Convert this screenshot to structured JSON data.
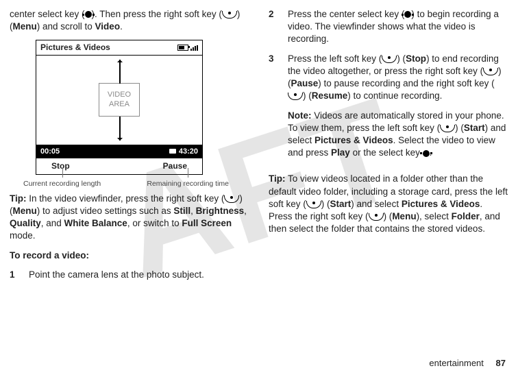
{
  "watermark": "AFT",
  "col1": {
    "intro_a": "center select key (",
    "intro_b": "). Then press the right soft key (",
    "intro_c": ") (",
    "intro_menu": "Menu",
    "intro_d": ") and scroll to ",
    "intro_video": "Video",
    "intro_e": ".",
    "tip_label": "Tip:",
    "tip_a": " In the video viewfinder, press the right soft key (",
    "tip_b": ") (",
    "tip_menu": "Menu",
    "tip_c": ") to adjust video settings such as ",
    "tip_still": "Still",
    "tip_sep1": ", ",
    "tip_brightness": "Brightness",
    "tip_sep2": ", ",
    "tip_quality": "Quality",
    "tip_sep3": ", and ",
    "tip_wb": "White Balance",
    "tip_d": ", or switch to ",
    "tip_full": "Full Screen",
    "tip_e": " mode.",
    "record_heading": "To record a video:",
    "step1_num": "1",
    "step1_text": "Point the camera lens at the photo subject."
  },
  "figure": {
    "title": "Pictures & Videos",
    "video_area_l1": "VIDEO",
    "video_area_l2": "AREA",
    "time_elapsed": "00:05",
    "time_remaining": "43:20",
    "soft_left": "Stop",
    "soft_right": "Pause",
    "label_left": "Current recording length",
    "label_right": "Remaining recording time"
  },
  "col2": {
    "step2_num": "2",
    "step2_a": "Press the center select key (",
    "step2_b": ") to begin recording a video. The viewfinder shows what the video is recording.",
    "step3_num": "3",
    "step3_a": "Press  the left soft key (",
    "step3_b": ") (",
    "step3_stop": "Stop",
    "step3_c": ") to end recording the video altogether, or press the right soft key (",
    "step3_d": ") (",
    "step3_pause": "Pause",
    "step3_e": ") to pause recording and the right soft key (",
    "step3_f": ") (",
    "step3_resume": "Resume",
    "step3_g": ") to continue recording.",
    "note_label": "Note:",
    "note_a": " Videos are automatically stored in your phone. To view them, press the left soft key (",
    "note_b": ") (",
    "note_start": "Start",
    "note_c": ") and select  ",
    "note_pv": "Pictures & Videos",
    "note_d": ". Select the video to view and press ",
    "note_play": "Play",
    "note_e": " or the select key ",
    "note_f": ".",
    "tip2_label": "Tip:",
    "tip2_a": " To view videos located in a folder other than the default video folder, including a storage card, press the left soft key (",
    "tip2_b": ") (",
    "tip2_start": "Start",
    "tip2_c": ") and select ",
    "tip2_pv": "Pictures & Videos",
    "tip2_d": ". Press the right soft key (",
    "tip2_e": ") (",
    "tip2_menu": "Menu",
    "tip2_f": "), select ",
    "tip2_folder": "Folder",
    "tip2_g": ", and then select the folder that contains the stored videos."
  },
  "footer": {
    "section": "entertainment",
    "page": "87"
  }
}
